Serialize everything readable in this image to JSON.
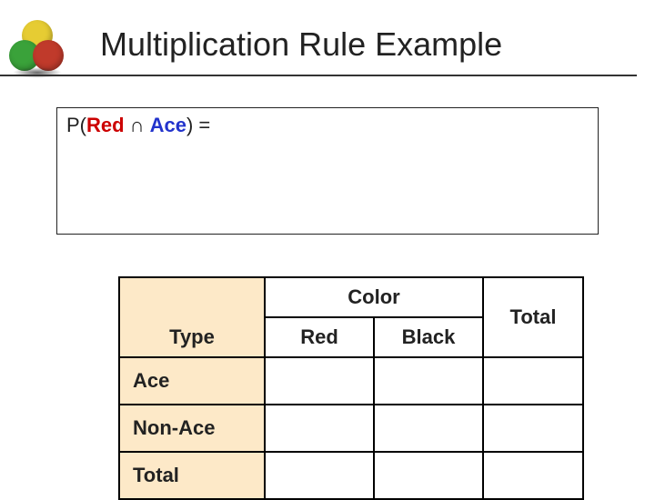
{
  "title": "Multiplication Rule Example",
  "formula": {
    "p_open": "P(",
    "term1": "Red",
    "cap": " ∩ ",
    "term2": "Ace",
    "close_eq": ") ="
  },
  "table": {
    "type_label": "Type",
    "color_label": "Color",
    "col_red": "Red",
    "col_black": "Black",
    "col_total": "Total",
    "rows": [
      {
        "label": "Ace",
        "red": "",
        "black": "",
        "total": ""
      },
      {
        "label": "Non-Ace",
        "red": "",
        "black": "",
        "total": ""
      },
      {
        "label": "Total",
        "red": "",
        "black": "",
        "total": ""
      }
    ]
  }
}
